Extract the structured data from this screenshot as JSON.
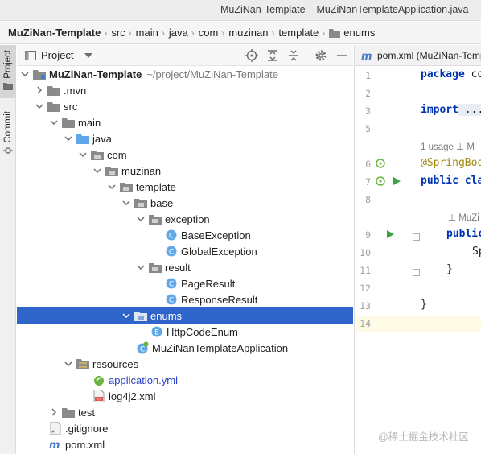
{
  "window": {
    "title": "MuZiNan-Template – MuZiNanTemplateApplication.java"
  },
  "breadcrumb": [
    "MuZiNan-Template",
    "src",
    "main",
    "java",
    "com",
    "muzinan",
    "template",
    "enums"
  ],
  "tool_stripe": {
    "project_tab": "Project",
    "commit_tab": "Commit"
  },
  "project_panel": {
    "title": "Project",
    "tree": [
      {
        "label": "MuZiNan-Template",
        "path": "~/project/MuZiNan-Template",
        "icon": "module-folder-icon",
        "expanded": true,
        "bold": true
      },
      {
        "label": ".mvn",
        "icon": "folder-icon",
        "expanded": false
      },
      {
        "label": "src",
        "icon": "folder-icon",
        "expanded": true
      },
      {
        "label": "main",
        "icon": "folder-icon",
        "expanded": true
      },
      {
        "label": "java",
        "icon": "source-folder-icon",
        "expanded": true
      },
      {
        "label": "com",
        "icon": "package-icon",
        "expanded": true
      },
      {
        "label": "muzinan",
        "icon": "package-icon",
        "expanded": true
      },
      {
        "label": "template",
        "icon": "package-icon",
        "expanded": true
      },
      {
        "label": "base",
        "icon": "package-icon",
        "expanded": true
      },
      {
        "label": "exception",
        "icon": "package-icon",
        "expanded": true
      },
      {
        "label": "BaseException",
        "icon": "class-icon"
      },
      {
        "label": "GlobalException",
        "icon": "class-icon"
      },
      {
        "label": "result",
        "icon": "package-icon",
        "expanded": true
      },
      {
        "label": "PageResult",
        "icon": "class-icon"
      },
      {
        "label": "ResponseResult",
        "icon": "class-icon"
      },
      {
        "label": "enums",
        "icon": "package-icon",
        "expanded": true,
        "selected": true
      },
      {
        "label": "HttpCodeEnum",
        "icon": "enum-icon"
      },
      {
        "label": "MuZiNanTemplateApplication",
        "icon": "spring-boot-class-icon"
      },
      {
        "label": "resources",
        "icon": "resources-folder-icon",
        "expanded": true
      },
      {
        "label": "application.yml",
        "icon": "yaml-file-icon",
        "blue": true
      },
      {
        "label": "log4j2.xml",
        "icon": "xml-file-icon"
      },
      {
        "label": "test",
        "icon": "folder-icon",
        "expanded": false
      },
      {
        "label": ".gitignore",
        "icon": "gitignore-file-icon"
      },
      {
        "label": "pom.xml",
        "icon": "maven-file-icon"
      }
    ]
  },
  "editor": {
    "tab": "pom.xml (MuZiNan-Temp",
    "line_numbers": [
      "1",
      "2",
      "3",
      "5",
      "6",
      "7",
      "8",
      "9",
      "10",
      "11",
      "12",
      "13",
      "14"
    ],
    "code": {
      "line1_kw": "package",
      "line1_rest": " co",
      "line3_kw": "import",
      "line3_rest": " ...",
      "usage_hint": "1 usage  ⊥ M",
      "line6": "@SpringBoo",
      "line7_kw": "public",
      "line7_rest": " cla",
      "author_hint": "⊥ MuZi",
      "line9_kw": "public",
      "line10": "Sp",
      "line11": "}",
      "line13": "}"
    }
  },
  "watermark": "@稀土掘金技术社区",
  "colors": {
    "selection": "#2f65ca",
    "keyword": "#0033b3",
    "annotation": "#9e880d",
    "run": "#3da246"
  }
}
